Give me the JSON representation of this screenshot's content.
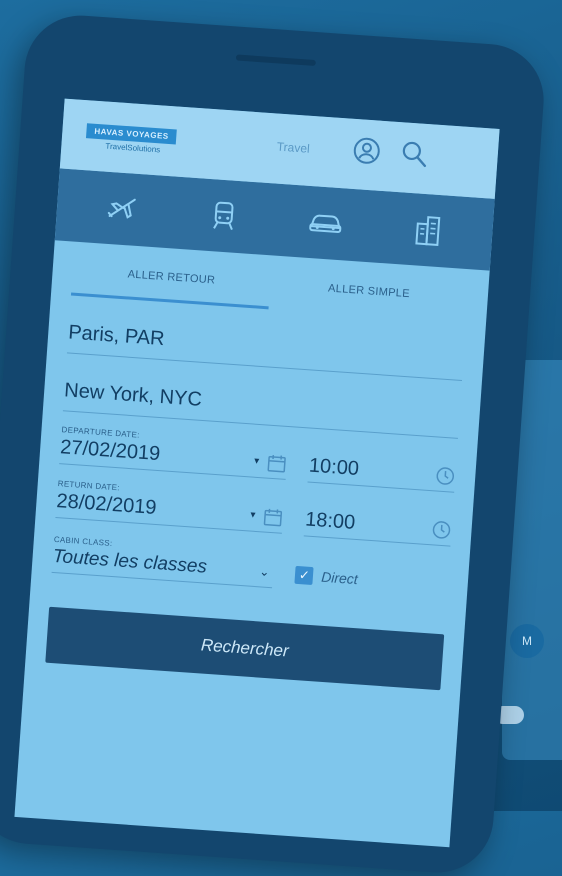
{
  "header": {
    "logo_primary": "HAVAS VOYAGES",
    "logo_secondary": "TravelSolutions",
    "travel_link": "Travel"
  },
  "transport_tabs": [
    {
      "icon": "plane-icon"
    },
    {
      "icon": "train-icon"
    },
    {
      "icon": "car-icon"
    },
    {
      "icon": "hotel-icon"
    }
  ],
  "trip_tabs": [
    {
      "label": "ALLER RETOUR",
      "active": true
    },
    {
      "label": "ALLER SIMPLE",
      "active": false
    }
  ],
  "origin": {
    "value": "Paris, PAR"
  },
  "destination": {
    "value": "New York, NYC"
  },
  "departure": {
    "label": "DEPARTURE DATE:",
    "date": "27/02/2019",
    "time": "10:00"
  },
  "return": {
    "label": "RETURN DATE:",
    "date": "28/02/2019",
    "time": "18:00"
  },
  "cabin": {
    "label": "CABIN CLASS:",
    "value": "Toutes les classes"
  },
  "direct": {
    "label": "Direct",
    "checked": true
  },
  "search_button": {
    "label": "Rechercher"
  },
  "background": {
    "badge_text": "M"
  },
  "colors": {
    "background": "#175c8a",
    "screen": "#7fc6ec",
    "transport_bar": "#2f6e9e",
    "button": "#1d4d75",
    "accent": "#3b8fd0"
  }
}
